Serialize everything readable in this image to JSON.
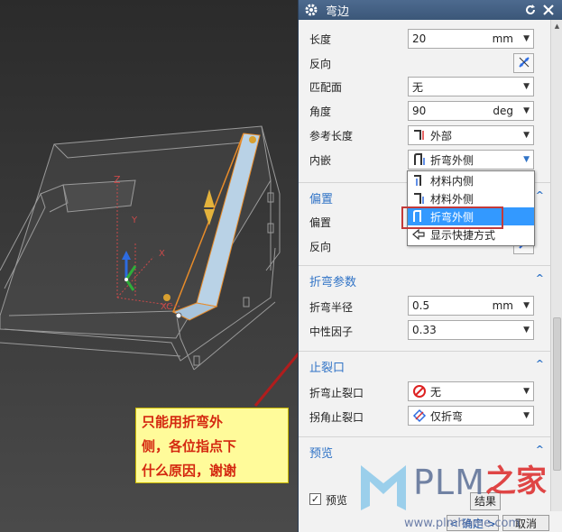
{
  "dialog": {
    "title": "弯边",
    "fields": {
      "length": {
        "label": "长度",
        "value": "20",
        "unit": "mm"
      },
      "reverse": {
        "label": "反向"
      },
      "match_face": {
        "label": "匹配面",
        "value": "无"
      },
      "angle": {
        "label": "角度",
        "value": "90",
        "unit": "deg"
      },
      "ref_length": {
        "label": "参考长度",
        "value": "外部"
      },
      "inset": {
        "label": "内嵌",
        "value": "折弯外侧"
      }
    },
    "inset_options": [
      "材料内侧",
      "材料外侧",
      "折弯外侧",
      "显示快捷方式"
    ],
    "inset_selected": "折弯外侧",
    "offset_section": {
      "title": "偏置",
      "offset_label": "偏置",
      "reverse_label": "反向"
    },
    "bend_params": {
      "title": "折弯参数",
      "radius_label": "折弯半径",
      "radius_value": "0.5",
      "radius_unit": "mm",
      "neutral_label": "中性因子",
      "neutral_value": "0.33"
    },
    "relief": {
      "title": "止裂口",
      "bend_relief_label": "折弯止裂口",
      "bend_relief_value": "无",
      "corner_relief_label": "拐角止裂口",
      "corner_relief_value": "仅折弯"
    },
    "preview": {
      "title": "预览",
      "checkbox_label": "预览",
      "result_label": "结果"
    },
    "ok_label": "< 确定 >",
    "cancel_label": "取消"
  },
  "annotation": {
    "lines": [
      "只能用折弯外",
      "侧，各位指点下",
      "什么原因，谢谢"
    ]
  },
  "watermark": {
    "brand": "PLM",
    "brand_cn": "之家",
    "url": "www.plmhome.com"
  },
  "colors": {
    "accent": "#3073c6",
    "title_bar": "#3b5778",
    "selection": "#3399ff",
    "annotation_bg": "#fffb9a",
    "annotation_text": "#d4270f",
    "highlight_border": "#c23a3a"
  },
  "icons": [
    "gear-icon",
    "reset-icon",
    "close-icon",
    "reverse-direction-icon",
    "ref-length-external-icon",
    "inset-bend-outer-icon",
    "no-relief-icon",
    "corner-bend-only-icon",
    "caret-up-icon"
  ]
}
